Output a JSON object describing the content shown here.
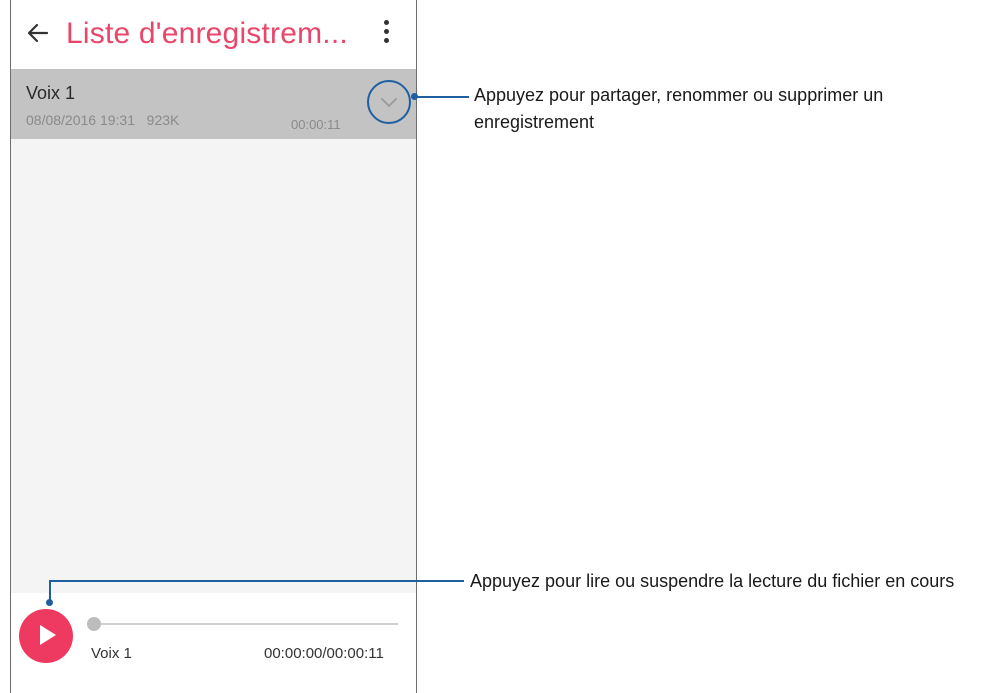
{
  "appbar": {
    "title": "Liste d'enregistrem...",
    "back_icon": "arrow-left-icon",
    "menu_icon": "more-vertical-icon"
  },
  "recordings": [
    {
      "name": "Voix 1",
      "meta": "08/08/2016 19:31   923K",
      "duration": "00:00:11",
      "expand_icon": "chevron-down-icon"
    }
  ],
  "player": {
    "title": "Voix 1",
    "time": "00:00:00/00:00:11",
    "progress": 0,
    "play_icon": "play-icon"
  },
  "callouts": {
    "expand_line1": "Appuyez pour partager, renommer ou supprimer un",
    "expand_line2": "enregistrement",
    "play": "Appuyez pour lire ou suspendre la lecture du fichier en cours"
  },
  "colors": {
    "accent": "#e8466a",
    "play_button": "#ee3960",
    "callout": "#1f5fa0",
    "selected_row": "#c3c3c3"
  }
}
